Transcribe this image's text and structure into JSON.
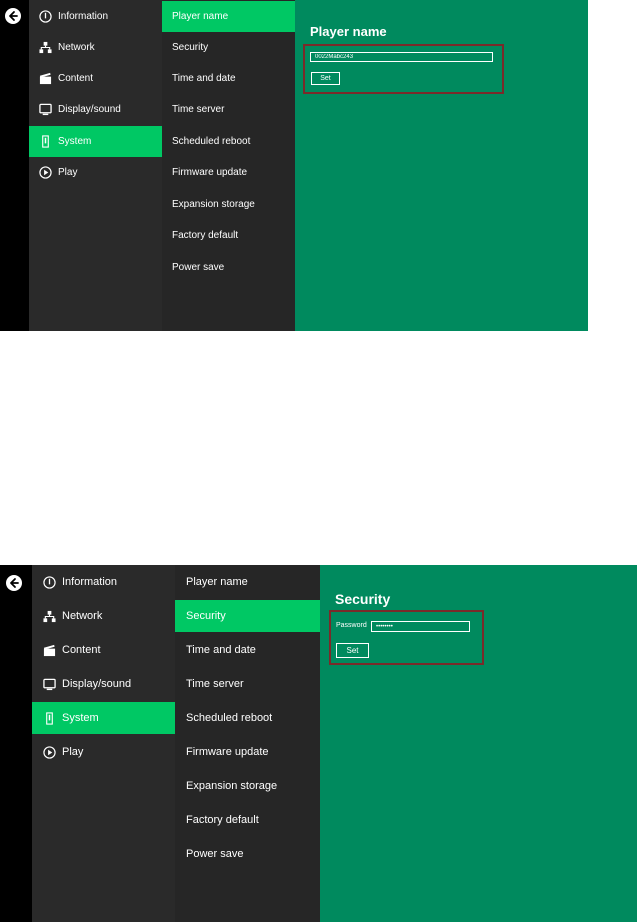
{
  "colors": {
    "back_bar": "#000000",
    "menu_bg": "#2a2a2a",
    "submenu_bg": "#262626",
    "accent_active": "#00c864",
    "panel_bg": "#008a5e",
    "highlight_border": "#7a2a2a"
  },
  "menu": {
    "items": [
      {
        "label": "Information",
        "icon": "info-icon"
      },
      {
        "label": "Network",
        "icon": "network-icon"
      },
      {
        "label": "Content",
        "icon": "clapperboard-icon"
      },
      {
        "label": "Display/sound",
        "icon": "monitor-icon"
      },
      {
        "label": "System",
        "icon": "system-icon",
        "active": true
      },
      {
        "label": "Play",
        "icon": "play-icon"
      }
    ]
  },
  "submenu": {
    "items": [
      "Player name",
      "Security",
      "Time and date",
      "Time server",
      "Scheduled reboot",
      "Firmware update",
      "Expansion storage",
      "Factory default",
      "Power save"
    ]
  },
  "screen1": {
    "active_submenu": "Player name",
    "panel": {
      "title": "Player name",
      "player_name_value": "0022Mabc243",
      "set_label": "Set"
    }
  },
  "screen2": {
    "active_submenu": "Security",
    "panel": {
      "title": "Security",
      "password_label": "Password",
      "password_value": "••••••••",
      "set_label": "Set"
    }
  }
}
